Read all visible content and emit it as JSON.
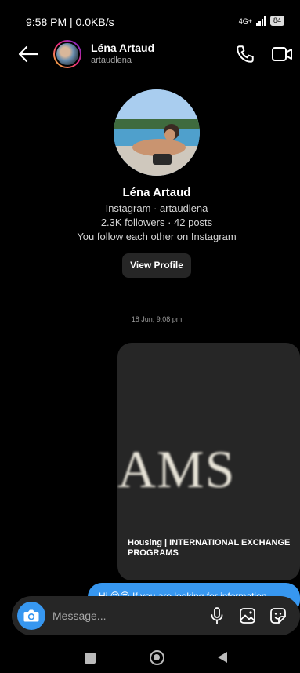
{
  "status_bar": {
    "time": "9:58 PM | 0.0KB/s",
    "network": "4G+",
    "battery": "84"
  },
  "header": {
    "name": "Léna Artaud",
    "username": "artaudlena"
  },
  "profile": {
    "name": "Léna Artaud",
    "line1": "Instagram · artaudlena",
    "line2": "2.3K followers · 42 posts",
    "line3": "You follow each other on Instagram",
    "view_profile_label": "View Profile"
  },
  "thread": {
    "timestamp": "18 Jun, 9:08 pm",
    "shared_post": {
      "image_text": "AMS",
      "caption": "Housing | INTERNATIONAL EXCHANGE PROGRAMS"
    },
    "partial_message": "Hi 😍😍 If you are looking for information"
  },
  "composer": {
    "placeholder": "Message..."
  },
  "icons": {
    "back": "back-arrow-icon",
    "call": "phone-icon",
    "video": "video-camera-icon",
    "camera": "camera-icon",
    "mic": "microphone-icon",
    "gallery": "gallery-icon",
    "sticker": "sticker-icon"
  },
  "colors": {
    "background": "#000000",
    "accent": "#3797f0",
    "surface": "#262626"
  }
}
